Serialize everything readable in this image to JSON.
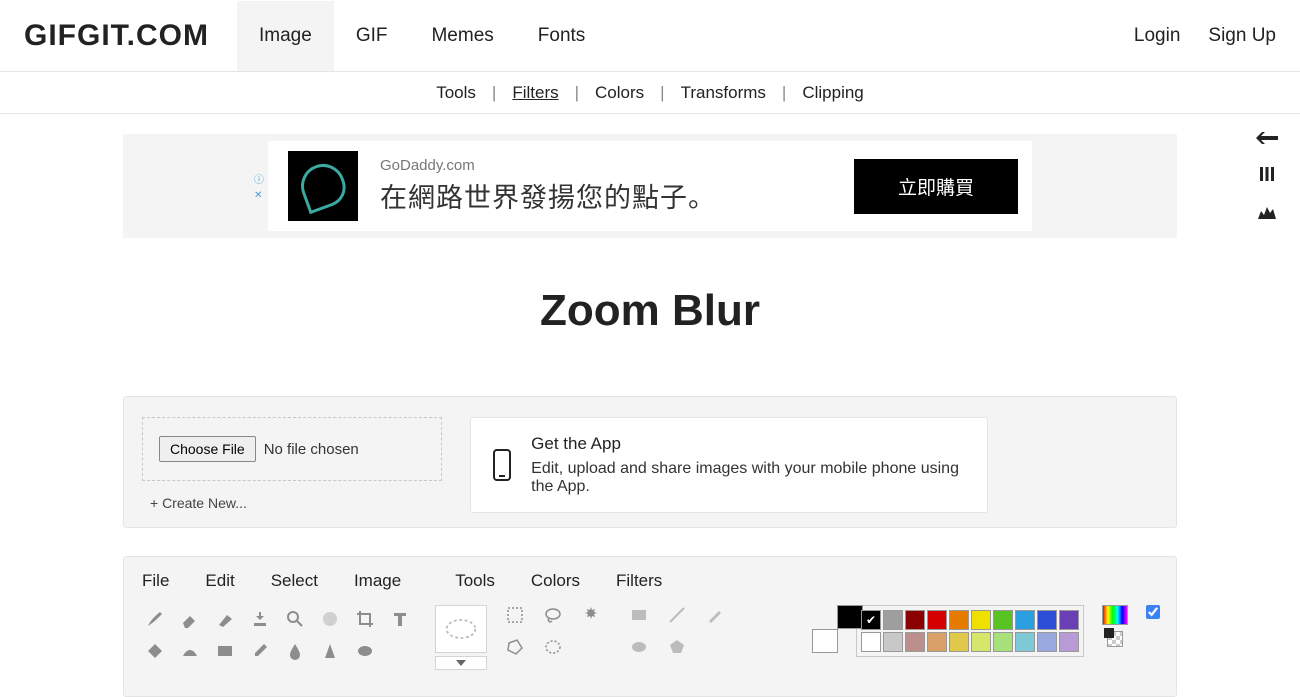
{
  "header": {
    "logo": "GIFGIT.COM",
    "nav": [
      "Image",
      "GIF",
      "Memes",
      "Fonts"
    ],
    "nav_active": 0,
    "auth": {
      "login": "Login",
      "signup": "Sign Up"
    }
  },
  "subnav": {
    "items": [
      "Tools",
      "Filters",
      "Colors",
      "Transforms",
      "Clipping"
    ],
    "active": 1,
    "separator": "|"
  },
  "ad": {
    "source": "GoDaddy.com",
    "title": "在網路世界發揚您的點子。",
    "cta": "立即購買"
  },
  "page_title": "Zoom Blur",
  "upload": {
    "choose_label": "Choose File",
    "no_file": "No file chosen",
    "create_new": "+ Create New..."
  },
  "app_card": {
    "title": "Get the App",
    "desc": "Edit, upload and share images with your mobile phone using the App."
  },
  "editor": {
    "menus": [
      "File",
      "Edit",
      "Select",
      "Image",
      "Tools",
      "Colors",
      "Filters"
    ]
  },
  "colors": {
    "foreground": "#000000",
    "background": "#ffffff",
    "palette": [
      "#000000",
      "#9e9e9e",
      "#8b0000",
      "#d40000",
      "#e57c00",
      "#f0e000",
      "#58c322",
      "#2aa0e0",
      "#2b4fd6",
      "#6a3fb5",
      "#ffffff",
      "#c8c8c8",
      "#bc8f8f",
      "#d9a06a",
      "#e0c94a",
      "#d6e66a",
      "#a8e07a",
      "#7fc8d6",
      "#9aa8e0",
      "#b89ad6"
    ],
    "selected_index": 0
  }
}
